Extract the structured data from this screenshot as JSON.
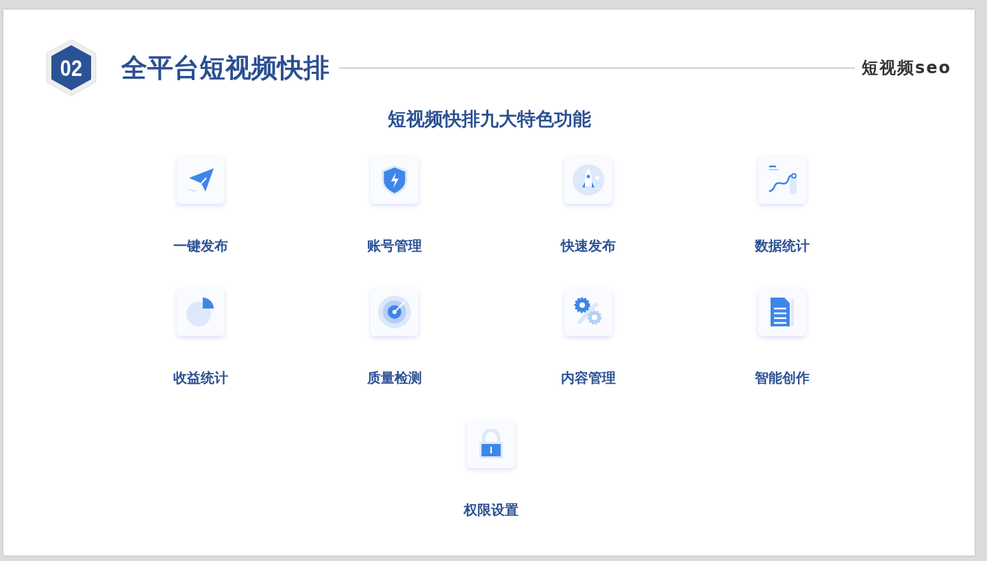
{
  "header": {
    "number": "02",
    "title": "全平台短视频快排",
    "tag": "短视频seo"
  },
  "subtitle": "短视频快排九大特色功能",
  "features": [
    {
      "label": "一键发布",
      "kind": "send"
    },
    {
      "label": "账号管理",
      "kind": "shield"
    },
    {
      "label": "快速发布",
      "kind": "rocket"
    },
    {
      "label": "数据统计",
      "kind": "trend"
    },
    {
      "label": "收益统计",
      "kind": "pie"
    },
    {
      "label": "质量检测",
      "kind": "target"
    },
    {
      "label": "内容管理",
      "kind": "gears"
    },
    {
      "label": "智能创作",
      "kind": "document"
    },
    {
      "label": "权限设置",
      "kind": "lock"
    }
  ]
}
